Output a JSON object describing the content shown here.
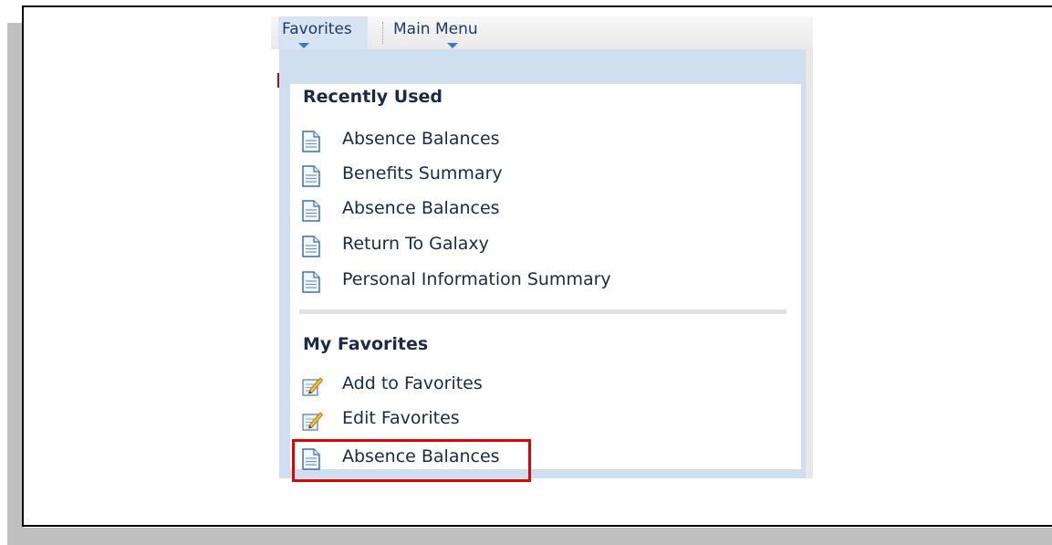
{
  "menubar": {
    "favorites_label": "Favorites",
    "main_menu_label": "Main Menu"
  },
  "dropdown": {
    "recently_used": {
      "title": "Recently Used",
      "items": [
        {
          "label": "Absence Balances",
          "icon": "document-icon"
        },
        {
          "label": "Benefits Summary",
          "icon": "document-icon"
        },
        {
          "label": "Absence Balances",
          "icon": "document-icon"
        },
        {
          "label": "Return To Galaxy",
          "icon": "document-icon"
        },
        {
          "label": "Personal Information Summary",
          "icon": "document-icon"
        }
      ]
    },
    "my_favorites": {
      "title": "My Favorites",
      "items": [
        {
          "label": "Add to Favorites",
          "icon": "edit-pencil-icon"
        },
        {
          "label": "Edit Favorites",
          "icon": "edit-pencil-icon"
        },
        {
          "label": "Absence Balances",
          "icon": "document-icon",
          "highlighted": true
        }
      ]
    }
  },
  "colors": {
    "accent": "#3a78c2",
    "dropdown_bg": "#cfdff0",
    "highlight": "#e10000"
  }
}
